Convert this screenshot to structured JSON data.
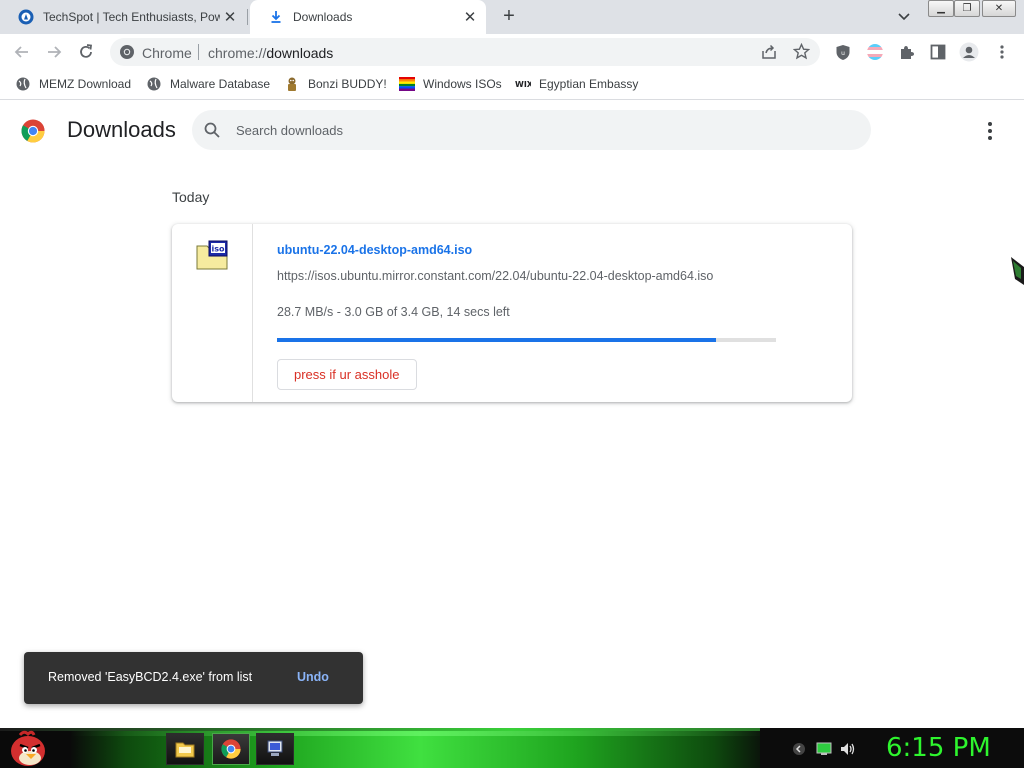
{
  "browser": {
    "tabs": [
      {
        "label": "TechSpot | Tech Enthusiasts, Pow",
        "active": false
      },
      {
        "label": "Downloads",
        "active": true
      }
    ],
    "omnibox": {
      "site": "Chrome",
      "url_prefix": "chrome://",
      "url_host": "downloads"
    },
    "bookmarks": [
      {
        "label": "MEMZ Download",
        "icon": "globe-icon"
      },
      {
        "label": "Malware Database",
        "icon": "globe-icon"
      },
      {
        "label": "Bonzi BUDDY!",
        "icon": "bonzi-icon"
      },
      {
        "label": "Windows ISOs",
        "icon": "rainbow-flag-icon"
      },
      {
        "label": "Egyptian Embassy",
        "icon": "wix-icon"
      }
    ]
  },
  "downloads_page": {
    "title": "Downloads",
    "search_placeholder": "Search downloads",
    "section_label": "Today",
    "items": [
      {
        "file_name": "ubuntu-22.04-desktop-amd64.iso",
        "url": "https://isos.ubuntu.mirror.constant.com/22.04/ubuntu-22.04-desktop-amd64.iso",
        "status": "28.7 MB/s - 3.0 GB of 3.4 GB, 14 secs left",
        "progress": 0.88,
        "button_label": "press if ur asshole",
        "icon": "iso-file-icon"
      }
    ]
  },
  "toast": {
    "message": "Removed 'EasyBCD2.4.exe' from list",
    "action": "Undo"
  },
  "taskbar": {
    "clock": "6:15 PM"
  },
  "colors": {
    "accent": "#1a73e8",
    "danger": "#d93025",
    "clock": "#2ef52e",
    "toast_bg": "#323232"
  }
}
